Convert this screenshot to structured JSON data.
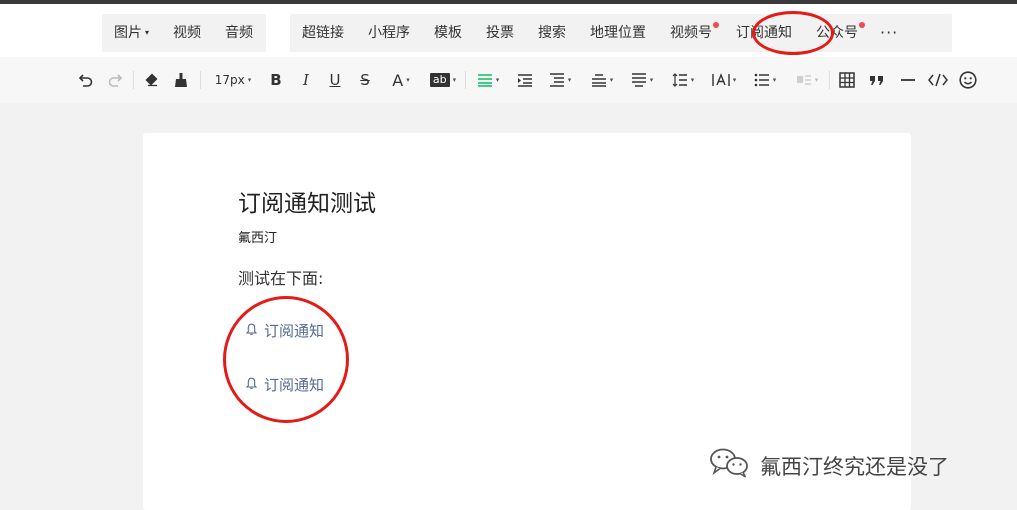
{
  "menu": {
    "media": [
      {
        "label": "图片",
        "caret": "▾"
      },
      {
        "label": "视频"
      },
      {
        "label": "音频"
      }
    ],
    "insert": [
      {
        "label": "超链接"
      },
      {
        "label": "小程序"
      },
      {
        "label": "模板"
      },
      {
        "label": "投票"
      },
      {
        "label": "搜索"
      },
      {
        "label": "地理位置"
      },
      {
        "label": "视频号"
      },
      {
        "label": "订阅通知"
      },
      {
        "label": "公众号"
      },
      {
        "label": "···"
      }
    ]
  },
  "toolbar": {
    "font_size": "17px",
    "bold": "B",
    "italic": "I",
    "underline": "U",
    "strike": "S",
    "font_color": "A",
    "bg_color": "ab",
    "caret": "▾"
  },
  "article": {
    "title": "订阅通知测试",
    "author": "氟西汀",
    "paragraph": "测试在下面:",
    "subscribe_1": "订阅通知",
    "subscribe_2": "订阅通知"
  },
  "watermark": {
    "text": "氟西汀终究还是没了"
  },
  "colors": {
    "link": "#576b95",
    "annotation": "#e41b17",
    "badge": "#f0494f",
    "align_active": "#07c160"
  }
}
